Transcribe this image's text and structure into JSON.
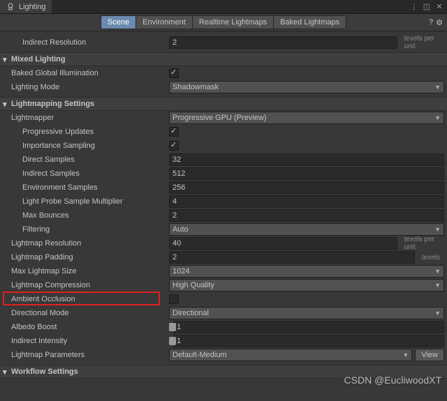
{
  "window": {
    "title": "Lighting"
  },
  "toolbar": {
    "tabs": [
      "Scene",
      "Environment",
      "Realtime Lightmaps",
      "Baked Lightmaps"
    ],
    "active": 0
  },
  "rows": {
    "indirect_resolution": {
      "label": "Indirect Resolution",
      "value": "2",
      "unit": "texels per unit"
    }
  },
  "sections": {
    "mixed_lighting": "Mixed Lighting",
    "lightmapping": "Lightmapping Settings",
    "workflow": "Workflow Settings"
  },
  "mixed": {
    "baked_gi": {
      "label": "Baked Global Illumination",
      "checked": true
    },
    "lighting_mode": {
      "label": "Lighting Mode",
      "value": "Shadowmask"
    }
  },
  "lm": {
    "lightmapper": {
      "label": "Lightmapper",
      "value": "Progressive GPU (Preview)"
    },
    "prog_updates": {
      "label": "Progressive Updates",
      "checked": true
    },
    "imp_sampling": {
      "label": "Importance Sampling",
      "checked": true
    },
    "direct_samples": {
      "label": "Direct Samples",
      "value": "32"
    },
    "indirect_samples": {
      "label": "Indirect Samples",
      "value": "512"
    },
    "env_samples": {
      "label": "Environment Samples",
      "value": "256"
    },
    "probe_mult": {
      "label": "Light Probe Sample Multiplier",
      "value": "4"
    },
    "max_bounces": {
      "label": "Max Bounces",
      "value": "2"
    },
    "filtering": {
      "label": "Filtering",
      "value": "Auto"
    },
    "lm_res": {
      "label": "Lightmap Resolution",
      "value": "40",
      "unit": "texels per unit"
    },
    "lm_pad": {
      "label": "Lightmap Padding",
      "value": "2",
      "unit": "texels"
    },
    "max_size": {
      "label": "Max Lightmap Size",
      "value": "1024"
    },
    "compression": {
      "label": "Lightmap Compression",
      "value": "High Quality"
    },
    "ao": {
      "label": "Ambient Occlusion",
      "checked": false
    },
    "dir_mode": {
      "label": "Directional Mode",
      "value": "Directional"
    },
    "albedo": {
      "label": "Albedo Boost",
      "value": "1",
      "knob": 0
    },
    "indirect_int": {
      "label": "Indirect Intensity",
      "value": "1",
      "knob": 20
    },
    "params": {
      "label": "Lightmap Parameters",
      "value": "Default-Medium",
      "button": "View"
    }
  },
  "watermark": "CSDN @EucliwoodXT"
}
